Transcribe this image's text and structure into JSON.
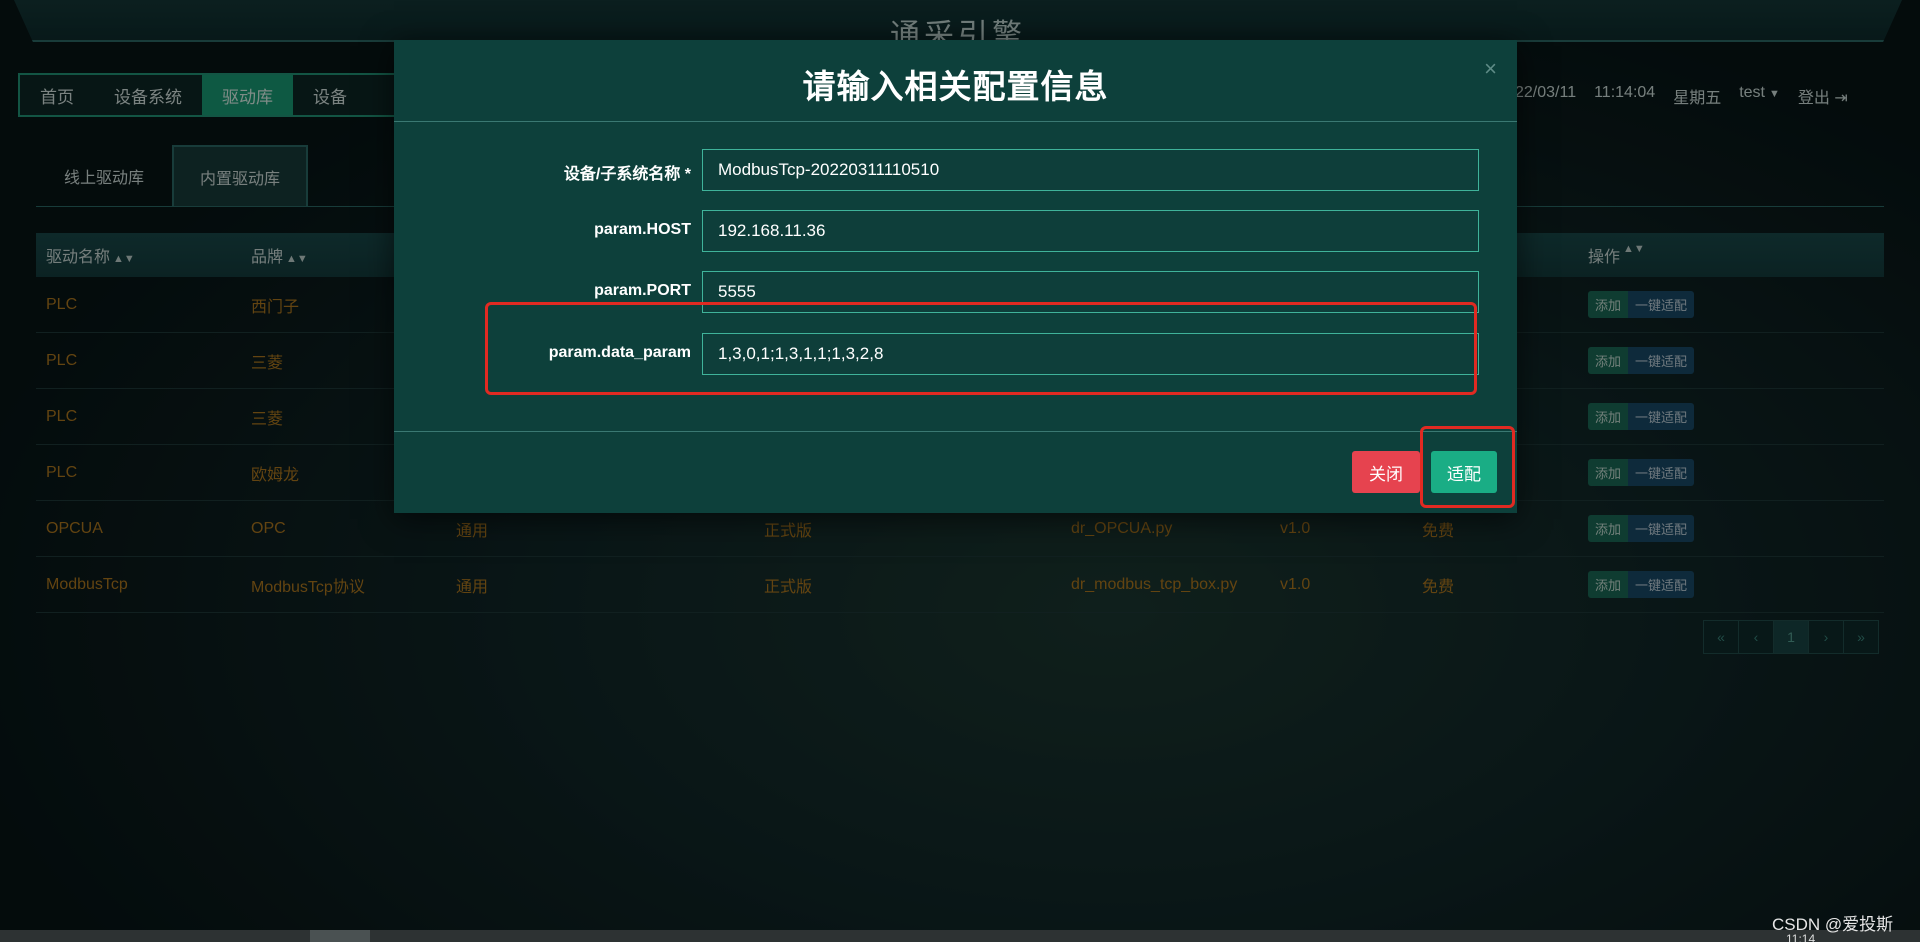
{
  "app": {
    "title": "通采引擎"
  },
  "nav": {
    "items": [
      {
        "label": "首页"
      },
      {
        "label": "设备系统"
      },
      {
        "label": "驱动库"
      },
      {
        "label": "设备"
      }
    ],
    "active_index": 2
  },
  "header": {
    "date": "22/03/11",
    "time": "11:14:04",
    "weekday": "星期五",
    "user": "test",
    "logout": "登出"
  },
  "tabs": [
    {
      "label": "线上驱动库"
    },
    {
      "label": "内置驱动库"
    }
  ],
  "table": {
    "headers": {
      "name": "驱动名称",
      "brand": "品牌",
      "action": "操作"
    },
    "rows": [
      {
        "name": "PLC",
        "brand": "西门子",
        "type": "",
        "edition": "",
        "file": "",
        "version": "",
        "price": ""
      },
      {
        "name": "PLC",
        "brand": "三菱",
        "type": "",
        "edition": "",
        "file": "",
        "version": "",
        "price": ""
      },
      {
        "name": "PLC",
        "brand": "三菱",
        "type": "",
        "edition": "",
        "file": "",
        "version": "",
        "price": ""
      },
      {
        "name": "PLC",
        "brand": "欧姆龙",
        "type": "",
        "edition": "",
        "file": "",
        "version": "",
        "price": ""
      },
      {
        "name": "OPCUA",
        "brand": "OPC",
        "type": "通用",
        "edition": "正式版",
        "file": "dr_OPCUA.py",
        "version": "v1.0",
        "price": "免费"
      },
      {
        "name": "ModbusTcp",
        "brand": "ModbusTcp协议",
        "type": "通用",
        "edition": "正式版",
        "file": "dr_modbus_tcp_box.py",
        "version": "v1.0",
        "price": "免费"
      }
    ],
    "add_label": "添加",
    "adapt_label": "一键适配"
  },
  "pagination": {
    "first": "«",
    "prev": "‹",
    "current": "1",
    "next": "›",
    "last": "»"
  },
  "modal": {
    "title": "请输入相关配置信息",
    "close_icon": "×",
    "fields": [
      {
        "label": "设备/子系统名称 *",
        "value": "ModbusTcp-20220311110510"
      },
      {
        "label": "param.HOST",
        "value": "192.168.11.36"
      },
      {
        "label": "param.PORT",
        "value": "5555"
      },
      {
        "label": "param.data_param",
        "value": "1,3,0,1;1,3,1,1;1,3,2,8"
      }
    ],
    "close_button": "关闭",
    "fit_button": "适配"
  },
  "footer": {
    "watermark": "CSDN @爱投斯",
    "tray_time": "11:14"
  },
  "colors": {
    "accent": "#1aad85",
    "danger": "#e6434f",
    "highlight": "#e02a22",
    "table_text": "#b57c1f"
  }
}
